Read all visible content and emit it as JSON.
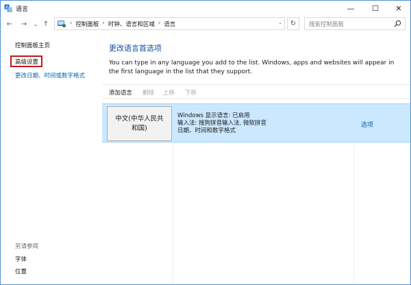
{
  "window": {
    "title": "语言",
    "min_glyph": "—",
    "max_glyph": "☐",
    "close_glyph": "✕"
  },
  "nav": {
    "back_glyph": "←",
    "forward_glyph": "→",
    "history_glyph": "⌄",
    "up_glyph": "↑",
    "breadcrumbs": [
      "控制面板",
      "时钟、语言和区域",
      "语言"
    ],
    "crumb_sep": "›",
    "refresh_glyph": "↻",
    "dropdown_glyph": "⌄"
  },
  "search": {
    "placeholder": "搜索控制面板"
  },
  "sidebar": {
    "items": [
      {
        "label": "控制面板主页"
      },
      {
        "label": "高级设置"
      },
      {
        "label": "更改日期、时间或数字格式"
      }
    ],
    "see_also_title": "另请参阅",
    "see_also": [
      {
        "label": "字体"
      },
      {
        "label": "位置"
      }
    ]
  },
  "main": {
    "title": "更改语言首选项",
    "description": "You can type in any language you add to the list. Windows, apps and websites will appear in the first language in the list that they support.",
    "toolbar": {
      "add": "添加语言",
      "remove": "删除",
      "move_up": "上移",
      "move_down": "下移"
    },
    "languages": [
      {
        "name": "中文(中华人民共和国)",
        "info_line1": "Windows 显示语言: 已启用",
        "info_line2": "输入法: 搜狗拼音输入法, 微软拼音",
        "info_line3": "日期、时间和数字格式",
        "options": "选项"
      }
    ]
  },
  "colors": {
    "accent_link": "#0063b1",
    "title_blue": "#0b4f9e",
    "selected_row": "#cce8ff",
    "highlight_box": "#c0151b"
  }
}
